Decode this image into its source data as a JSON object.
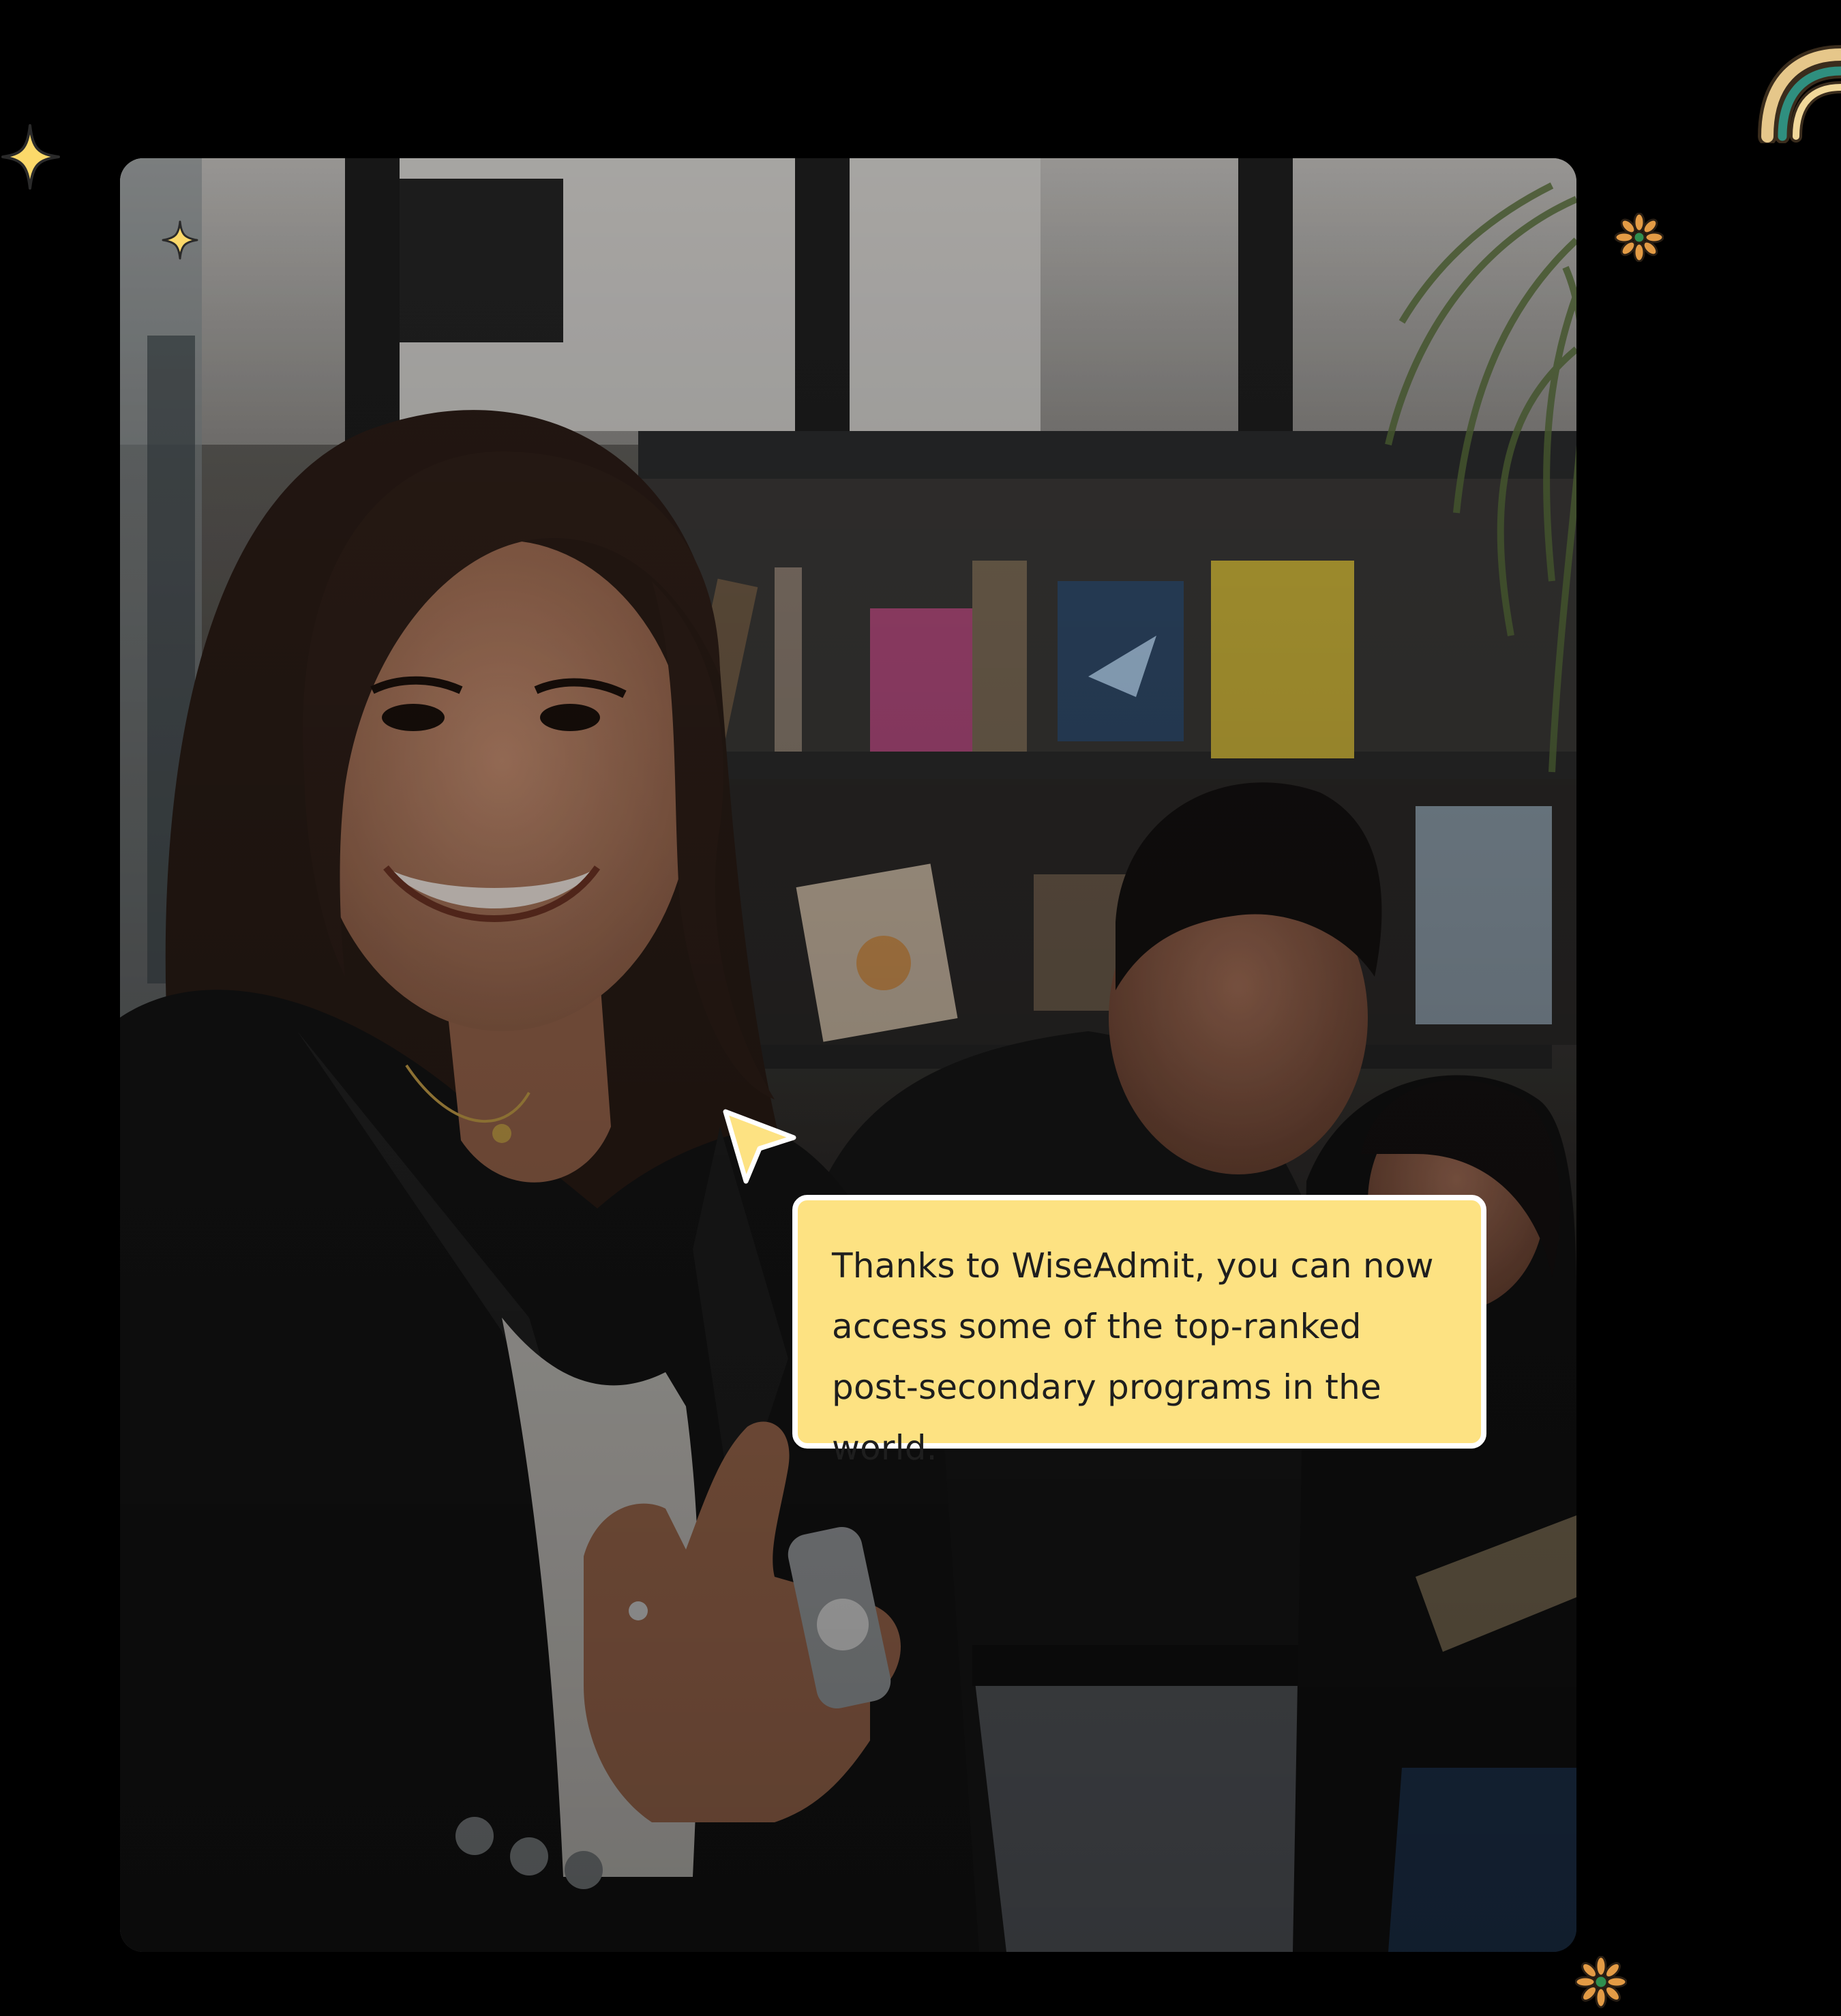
{
  "quote": {
    "text": "Thanks to WiseAdmit, you can now access some of the top-ranked post-secondary programs in the world."
  },
  "colors": {
    "background": "#000000",
    "bubble": "#fde282",
    "bubble_border": "#ffffff",
    "accent_yellow": "#fcd96a",
    "accent_orange": "#e39b45",
    "accent_teal": "#2f8f7f"
  },
  "icons": {
    "sparkle_large": "sparkle-icon",
    "sparkle_small": "sparkle-icon",
    "rainbow": "rainbow-icon",
    "flower_top": "flower-icon",
    "flower_bottom": "flower-icon",
    "cursor": "cursor-arrow-icon"
  }
}
